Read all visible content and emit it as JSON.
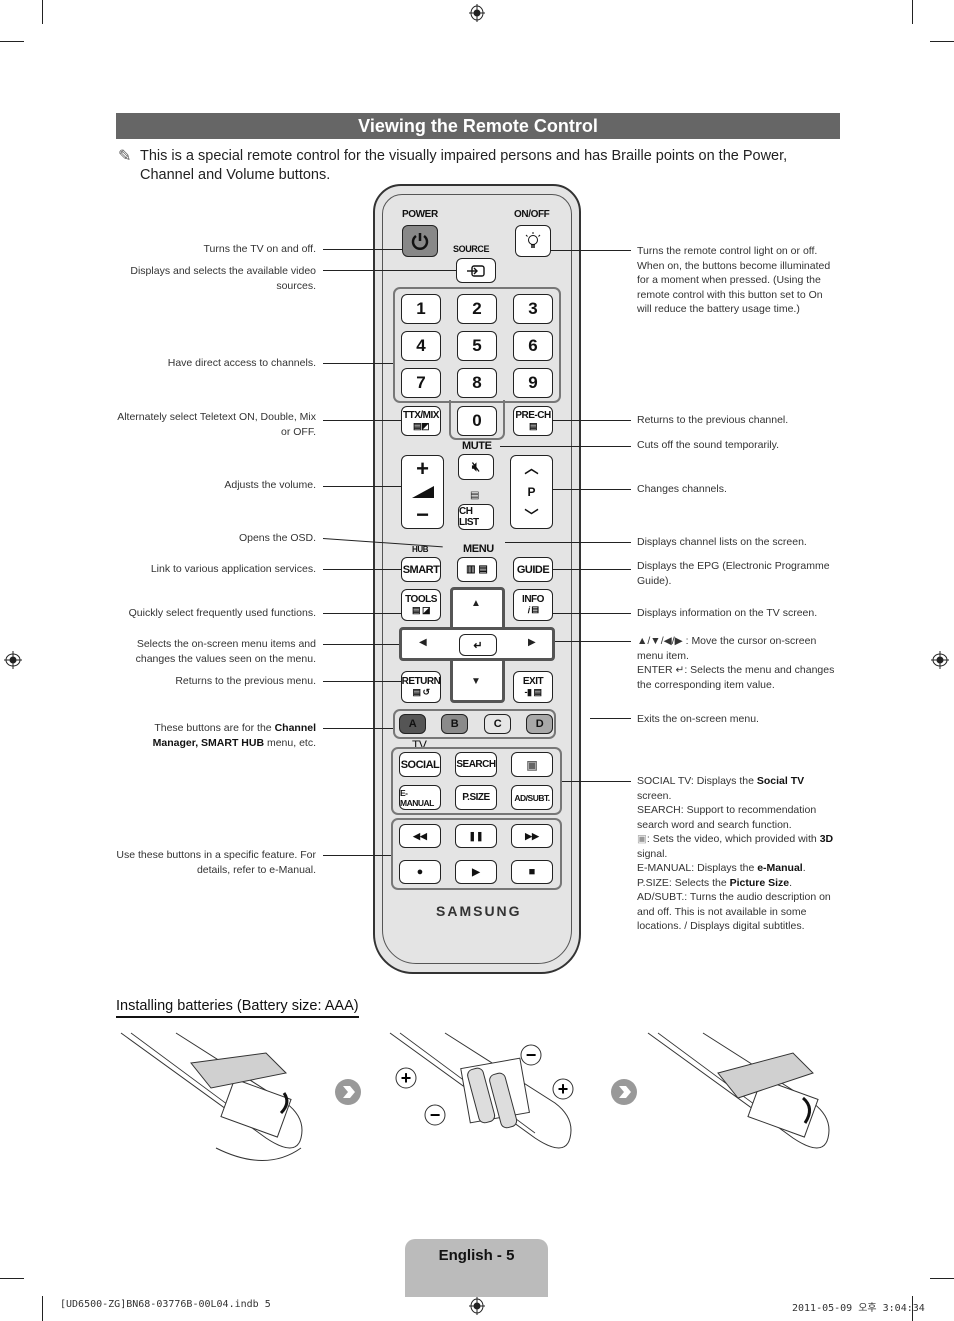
{
  "header": {
    "title": "Viewing the Remote Control"
  },
  "note": {
    "icon": "pencil-note-icon",
    "text": "This is a special remote control for the visually impaired persons and has Braille points on the Power, Channel and Volume buttons."
  },
  "remote": {
    "power_label": "POWER",
    "onoff_label": "ON/OFF",
    "source_label": "SOURCE",
    "numbers": [
      "1",
      "2",
      "3",
      "4",
      "5",
      "6",
      "7",
      "8",
      "9",
      "0"
    ],
    "ttx_label": "TTX/MIX",
    "prech_label": "PRE-CH",
    "mute_label": "MUTE",
    "chlist_label": "CH LIST",
    "p_label": "P",
    "hub_label": "HUB",
    "menu_label": "MENU",
    "smart_label": "SMART",
    "guide_label": "GUIDE",
    "tools_label": "TOOLS",
    "info_label": "INFO",
    "return_label": "RETURN",
    "exit_label": "EXIT",
    "color_buttons": [
      {
        "label": "A",
        "color": "#555555"
      },
      {
        "label": "B",
        "color": "#8a8a8a"
      },
      {
        "label": "C",
        "color": "#e6e6e6"
      },
      {
        "label": "D",
        "color": "#a8a8a8"
      }
    ],
    "tv_label": "TV",
    "social_label": "SOCIAL",
    "search_label": "SEARCH",
    "emanual_label": "E-MANUAL",
    "psize_label": "P.SIZE",
    "adsubt_label": "AD/SUBT.",
    "media": [
      "◀◀",
      "❚❚",
      "▶▶",
      "●",
      "▶",
      "■"
    ],
    "brand": "SAMSUNG"
  },
  "labels_left": [
    "Turns the TV on and off.",
    "Displays and selects the available video sources.",
    "Have direct access to channels.",
    "Alternately select Teletext ON, Double, Mix or OFF.",
    "Adjusts the volume.",
    "Opens the OSD.",
    "Link to various application services.",
    "Quickly select frequently used functions.",
    "Selects the on-screen menu items and changes the values seen on the menu.",
    "Returns to the previous menu.",
    "These buttons are for the",
    "Channel Manager, SMART HUB",
    "menu, etc.",
    "Use these buttons in a specific feature. For details, refer to e-Manual."
  ],
  "labels_right": {
    "onoff": "Turns the remote control light on or off. When on, the buttons become illuminated for a moment when pressed. (Using the remote control with this button set to On will reduce the battery usage time.)",
    "prech": "Returns to the previous channel.",
    "mute": "Cuts off the sound temporarily.",
    "channel": "Changes channels.",
    "chlist": "Displays channel lists on the screen.",
    "guide": "Displays the EPG (Electronic Programme Guide).",
    "info": "Displays information on the TV screen.",
    "arrows": "▲/▼/◀/▶ : Move the cursor on-screen menu item.",
    "enter_key": "ENTER",
    "enter_desc": ": Selects the menu and changes the corresponding item value.",
    "exit": "Exits the on-screen menu.",
    "social_key": "SOCIAL TV",
    "social_desc": ": Displays the ",
    "social_bold": "Social TV",
    "social_end": " screen.",
    "search_key": "SEARCH",
    "search_desc": ": Support to recommendation search word and search function.",
    "threed_desc": ": Sets the video, which provided with ",
    "threed_bold": "3D",
    "threed_end": " signal.",
    "emanual_key": "E-MANUAL:",
    "emanual_desc": " Displays the ",
    "emanual_bold": "e-Manual",
    "psize_key": "P.SIZE",
    "psize_desc": ": Selects the ",
    "psize_bold": "Picture Size",
    "adsubt_key": "AD/SUBT.",
    "adsubt_desc": ": Turns the audio description on and off. This is not available in some locations. / Displays digital subtitles."
  },
  "batteries": {
    "title": "Installing batteries (Battery size: AAA)"
  },
  "footer": {
    "page_label": "English - 5",
    "file_info": "[UD6500-ZG]BN68-03776B-00L04.indb   5",
    "timestamp": "2011-05-09   오후 3:04:34"
  }
}
